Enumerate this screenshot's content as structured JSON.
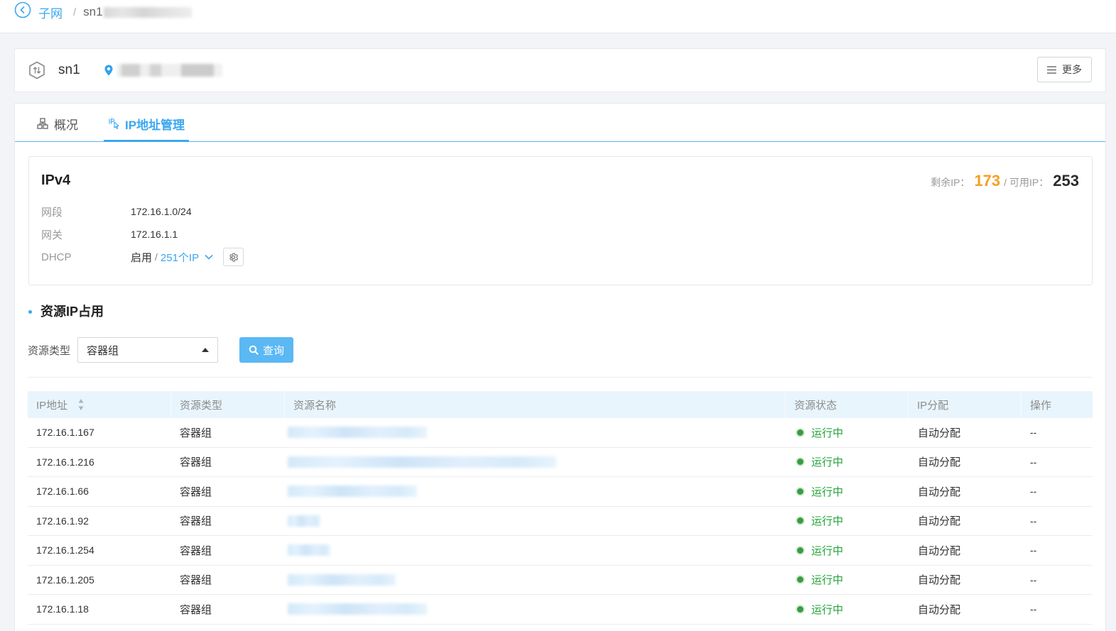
{
  "breadcrumb": {
    "parent": "子网",
    "separator": "/",
    "current": "sn1"
  },
  "header": {
    "name": "sn1",
    "more_label": "更多"
  },
  "tabs": [
    {
      "label": "概况",
      "active": false
    },
    {
      "label": "IP地址管理",
      "active": true
    }
  ],
  "ipv4": {
    "title": "IPv4",
    "remaining_label": "剩余IP：",
    "remaining_value": "173",
    "separator": "/",
    "available_label": "可用IP：",
    "available_value": "253",
    "subnet_label": "网段",
    "subnet_value": "172.16.1.0/24",
    "gateway_label": "网关",
    "gateway_value": "172.16.1.1",
    "dhcp_label": "DHCP",
    "dhcp_status": "启用",
    "dhcp_separator": "/",
    "dhcp_pool": "251个IP"
  },
  "resource_section": {
    "title": "资源IP占用",
    "filter_label": "资源类型",
    "filter_value": "容器组",
    "query_label": "查询"
  },
  "table": {
    "columns": [
      "IP地址",
      "资源类型",
      "资源名称",
      "资源状态",
      "IP分配",
      "操作"
    ],
    "rows": [
      {
        "ip": "172.16.1.167",
        "type": "容器组",
        "status": "运行中",
        "allocation": "自动分配",
        "action": "--"
      },
      {
        "ip": "172.16.1.216",
        "type": "容器组",
        "status": "运行中",
        "allocation": "自动分配",
        "action": "--"
      },
      {
        "ip": "172.16.1.66",
        "type": "容器组",
        "status": "运行中",
        "allocation": "自动分配",
        "action": "--"
      },
      {
        "ip": "172.16.1.92",
        "type": "容器组",
        "status": "运行中",
        "allocation": "自动分配",
        "action": "--"
      },
      {
        "ip": "172.16.1.254",
        "type": "容器组",
        "status": "运行中",
        "allocation": "自动分配",
        "action": "--"
      },
      {
        "ip": "172.16.1.205",
        "type": "容器组",
        "status": "运行中",
        "allocation": "自动分配",
        "action": "--"
      },
      {
        "ip": "172.16.1.18",
        "type": "容器组",
        "status": "运行中",
        "allocation": "自动分配",
        "action": "--"
      }
    ]
  },
  "colors": {
    "accent": "#3aa7ef",
    "query_button": "#5ab8f3",
    "remaining_ip": "#f5a020",
    "status_running": "#22a33a",
    "table_header_bg": "#e9f5fd",
    "page_bg": "#f2f4f7"
  },
  "icons": {
    "back": "back-circle-icon",
    "subnet": "subnet-hexagon-icon",
    "location": "location-pin-icon",
    "more": "menu-lines-icon",
    "tab_overview": "sitemap-icon",
    "tab_ip": "ip-address-icon",
    "dhcp_expand": "chevron-down-icon",
    "dhcp_settings": "gear-icon",
    "query": "search-icon",
    "sort": "sort-icon",
    "select": "caret-up-icon",
    "status": "status-dot-icon"
  }
}
